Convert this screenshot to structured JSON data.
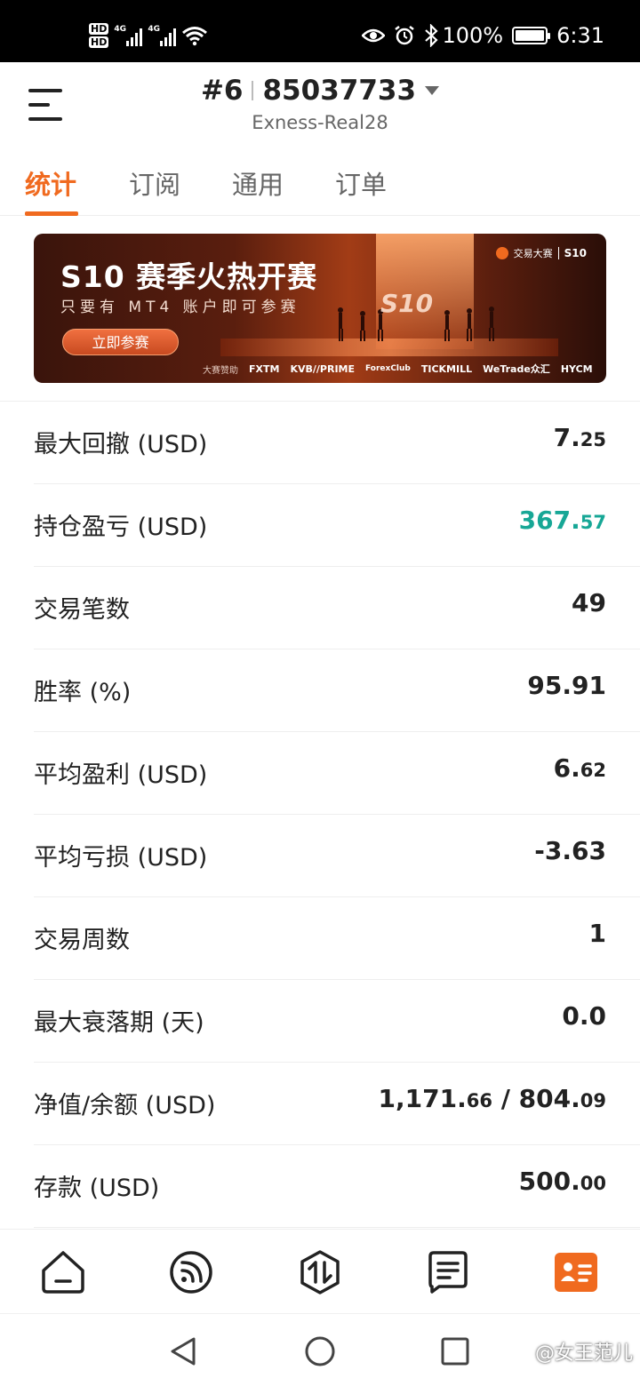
{
  "status_bar": {
    "hd1": "HD",
    "hd2": "HD",
    "net1": "4G",
    "net2": "4G",
    "battery": "100%",
    "time": "6:31",
    "battery_level": 1.0,
    "icons": [
      "wifi-icon",
      "eye-icon",
      "alarm-icon",
      "bluetooth-icon"
    ]
  },
  "header": {
    "rank": "#6",
    "account": "85037733",
    "server": "Exness-Real28"
  },
  "tabs": [
    {
      "label": "统计",
      "active": true
    },
    {
      "label": "订阅",
      "active": false
    },
    {
      "label": "通用",
      "active": false
    },
    {
      "label": "订单",
      "active": false
    }
  ],
  "banner": {
    "title": "S10 赛季火热开赛",
    "subtitle": "只要有 MT4 账户即可参赛",
    "button": "立即参赛",
    "big_s10": "S10",
    "brand": "交易大赛",
    "brand_season": "S10",
    "sponsor_label": "大赛赞助",
    "sponsors": [
      "FXTM",
      "KVB//PRIME",
      "ForexClub",
      "TICKMILL",
      "WeTrade众汇",
      "HYCM"
    ]
  },
  "stats": [
    {
      "label": "最大回撤 (USD)",
      "int": "7.",
      "dec": "25",
      "color": "#222222"
    },
    {
      "label": "持仓盈亏 (USD)",
      "int": "367.",
      "dec": "57",
      "color": "#17a796"
    },
    {
      "label": "交易笔数",
      "int": "49",
      "dec": "",
      "color": "#222222"
    },
    {
      "label": "胜率 (%)",
      "int": "95.91",
      "dec": "",
      "color": "#222222"
    },
    {
      "label": "平均盈利 (USD)",
      "int": "6.",
      "dec": "62",
      "color": "#222222"
    },
    {
      "label": "平均亏损 (USD)",
      "int": "-3.63",
      "dec": "",
      "color": "#222222"
    },
    {
      "label": "交易周数",
      "int": "1",
      "dec": "",
      "color": "#222222"
    },
    {
      "label": "最大衰落期 (天)",
      "int": "0.0",
      "dec": "",
      "color": "#222222"
    },
    {
      "label": "净值/余额 (USD)",
      "int": "1,171.",
      "dec": "66",
      "int2": " / 804.",
      "dec2": "09",
      "color": "#222222"
    },
    {
      "label": "存款 (USD)",
      "int": "500.",
      "dec": "00",
      "color": "#222222"
    }
  ],
  "bottom_nav": {
    "items": [
      "home-icon",
      "signal-feed-icon",
      "trade-icon",
      "message-icon",
      "profile-card-icon"
    ],
    "active_color": "#f06a1f"
  },
  "watermark": "@女王范儿",
  "colors": {
    "accent": "#f06a1f",
    "profit": "#17a796"
  }
}
